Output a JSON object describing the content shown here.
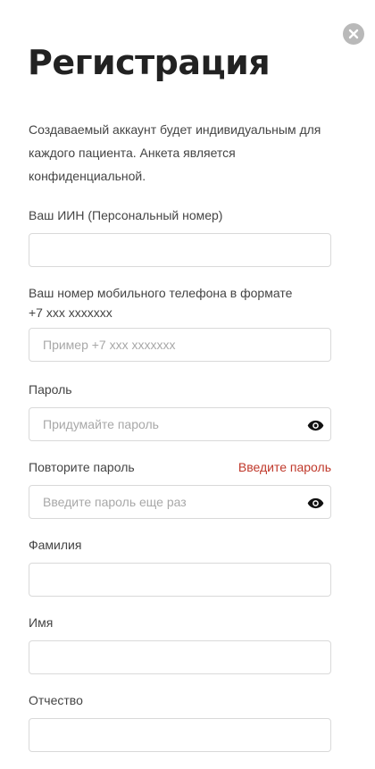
{
  "modal": {
    "title": "Регистрация",
    "intro": "Создаваемый аккаунт будет индивидуальным для каждого пациента. Анкета является конфиденциальной."
  },
  "fields": {
    "iin": {
      "label": "Ваш ИИН (Персональный номер)",
      "value": "",
      "placeholder": ""
    },
    "phone": {
      "label_line1": "Ваш номер мобильного телефона в формате",
      "label_line2": "+7 xxx xxxxxxx",
      "value": "",
      "placeholder": "Пример +7 xxx xxxxxxx"
    },
    "password": {
      "label": "Пароль",
      "value": "",
      "placeholder": "Придумайте пароль"
    },
    "password_repeat": {
      "label": "Повторите пароль",
      "error": "Введите пароль",
      "value": "",
      "placeholder": "Введите пароль еще раз"
    },
    "last_name": {
      "label": "Фамилия",
      "value": "",
      "placeholder": ""
    },
    "first_name": {
      "label": "Имя",
      "value": "",
      "placeholder": ""
    },
    "middle_name": {
      "label": "Отчество",
      "value": "",
      "placeholder": ""
    }
  },
  "icons": {
    "close": "close-icon",
    "eye": "eye-icon"
  },
  "colors": {
    "error": "#c0392b",
    "close_bg": "#b9b9b9",
    "border": "#d9d9d9"
  }
}
